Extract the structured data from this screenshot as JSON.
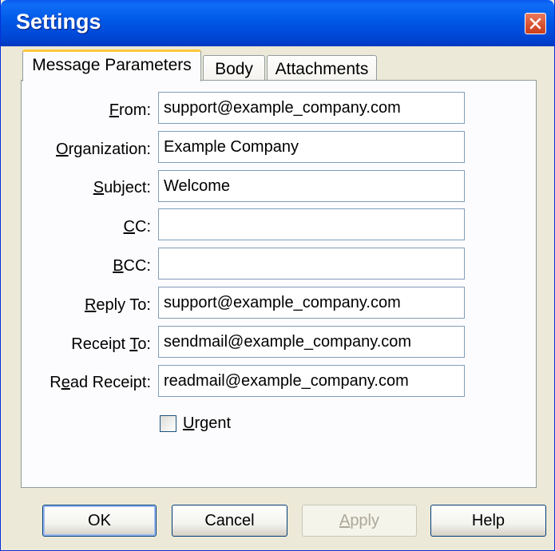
{
  "window": {
    "title": "Settings"
  },
  "tabs": [
    {
      "label": "Message Parameters",
      "active": true
    },
    {
      "label": "Body",
      "active": false
    },
    {
      "label": "Attachments",
      "active": false
    }
  ],
  "fields": {
    "from": {
      "label_pre": "",
      "label_key": "F",
      "label_post": "rom:",
      "value": "support@example_company.com"
    },
    "organization": {
      "label_pre": "",
      "label_key": "O",
      "label_post": "rganization:",
      "value": "Example Company"
    },
    "subject": {
      "label_pre": "",
      "label_key": "S",
      "label_post": "ubject:",
      "value": "Welcome"
    },
    "cc": {
      "label_pre": "",
      "label_key": "C",
      "label_post": "C:",
      "value": ""
    },
    "bcc": {
      "label_pre": "",
      "label_key": "B",
      "label_post": "CC:",
      "value": ""
    },
    "reply_to": {
      "label_pre": "",
      "label_key": "R",
      "label_post": "eply To:",
      "value": "support@example_company.com"
    },
    "receipt_to": {
      "label_pre": "Receipt ",
      "label_key": "T",
      "label_post": "o:",
      "value": "sendmail@example_company.com"
    },
    "read_receipt": {
      "label_pre": "R",
      "label_key": "e",
      "label_post": "ad Receipt:",
      "value": "readmail@example_company.com"
    }
  },
  "urgent": {
    "label_key": "U",
    "label_post": "rgent",
    "checked": false
  },
  "buttons": {
    "ok": {
      "label": "OK"
    },
    "cancel": {
      "label": "Cancel"
    },
    "apply": {
      "label_key": "A",
      "label_post": "pply",
      "enabled": false
    },
    "help": {
      "label": "Help"
    }
  },
  "colors": {
    "titlebar": "#0058e6",
    "close_button": "#d8502e",
    "active_tab_highlight": "#ffc83c",
    "input_border": "#7f9db9",
    "dialog_background": "#ece9d8"
  }
}
